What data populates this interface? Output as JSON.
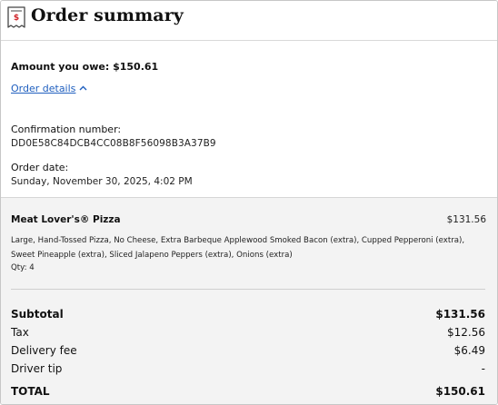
{
  "header": {
    "icon": "receipt-icon",
    "title": "Order summary"
  },
  "info": {
    "amount_owed": "Amount you owe: $150.61",
    "order_details_link": "Order details",
    "confirmation_label": "Confirmation number:",
    "confirmation_number": "DD0E58C84DCB4CC08B8F56098B3A37B9",
    "order_date_label": "Order date:",
    "order_date": "Sunday, November 30, 2025, 4:02 PM"
  },
  "items": [
    {
      "name": "Meat Lover's® Pizza",
      "price": "$131.56",
      "description": "Large, Hand-Tossed Pizza, No Cheese, Extra Barbeque Applewood Smoked Bacon (extra), Cupped Pepperoni (extra), Sweet Pineapple (extra), Sliced Jalapeno Peppers (extra), Onions (extra)",
      "qty": "Qty: 4"
    }
  ],
  "summary": {
    "subtotal_label": "Subtotal",
    "subtotal": "$131.56",
    "tax_label": "Tax",
    "tax": "$12.56",
    "delivery_label": "Delivery fee",
    "delivery": "$6.49",
    "tip_label": "Driver tip",
    "tip": "-",
    "total_label": "TOTAL",
    "total": "$150.61"
  },
  "colors": {
    "link": "#1f5fbf",
    "icon_accent": "#d0262c",
    "items_background": "#f3f3f3"
  }
}
